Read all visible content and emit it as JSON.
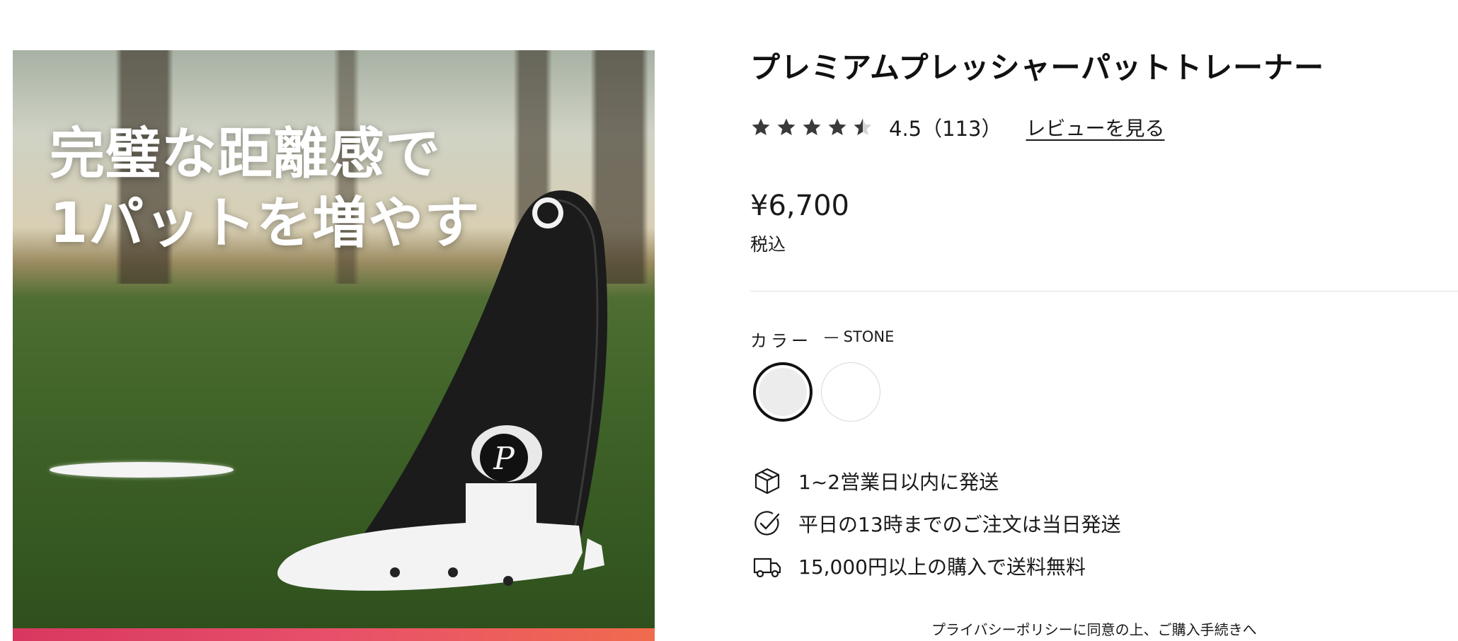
{
  "gallery": {
    "headline_line1": "完璧な距離感で",
    "headline_line2": "1パットを増やす",
    "logo_text": "P"
  },
  "product": {
    "title": "プレミアムプレッシャーパットトレーナー",
    "rating_value": 4.5,
    "rating_text": "4.5（113）",
    "review_link": "レビューを見る",
    "price": "¥6,700",
    "tax_note": "税込"
  },
  "color": {
    "label": "カラー",
    "selected": "— STONE",
    "swatches": [
      {
        "name": "STONE",
        "hex": "#ececec",
        "selected": true
      },
      {
        "name": "WHITE",
        "hex": "#ffffff",
        "selected": false
      }
    ]
  },
  "info": {
    "shipping": "1~2営業日以内に発送",
    "same_day": "平日の13時までのご注文は当日発送",
    "free_shipping": "15,000円以上の購入で送料無料"
  },
  "footer": {
    "privacy": "プライバシーポリシーに同意の上、ご購入手続きへ"
  },
  "icons": {
    "box": "package-icon",
    "check": "check-circle-icon",
    "truck": "truck-icon",
    "star": "star-icon"
  },
  "colors": {
    "text": "#1a1a1a",
    "star": "#3a3a3a",
    "selected_border": "#111111",
    "accent_strip": "#e8506a"
  }
}
